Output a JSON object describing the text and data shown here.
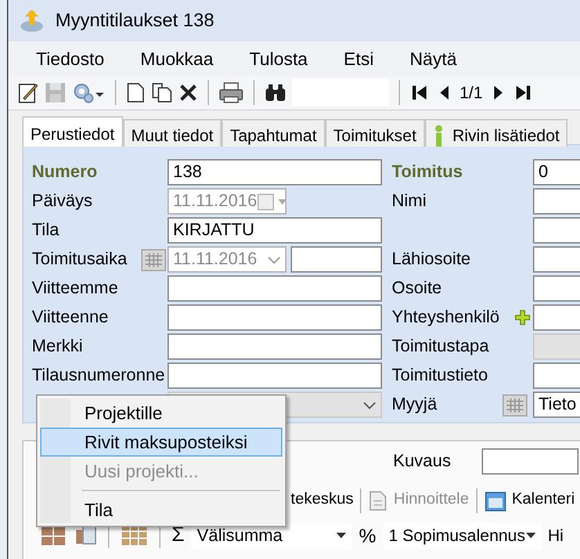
{
  "window": {
    "title": "Myyntitilaukset 138"
  },
  "menu_bar": [
    "Tiedosto",
    "Muokkaa",
    "Tulosta",
    "Etsi",
    "Näytä"
  ],
  "toolbar": {
    "page": "1/1"
  },
  "tabs": [
    {
      "label": "Perustiedot",
      "selected": true
    },
    {
      "label": "Muut tiedot",
      "selected": false
    },
    {
      "label": "Tapahtumat",
      "selected": false
    },
    {
      "label": "Toimitukset",
      "selected": false
    },
    {
      "label": "Rivin lisätiedot",
      "selected": false,
      "kind": "info"
    }
  ],
  "form": {
    "left": [
      {
        "label": "Numero",
        "emphasis": true,
        "kind": "text",
        "value": "138"
      },
      {
        "label": "Päiväys",
        "kind": "date",
        "value": "11.11.2016",
        "disabled": true
      },
      {
        "label": "Tila",
        "kind": "text",
        "value": "KIRJATTU"
      },
      {
        "label": "Toimitusaika",
        "kind": "date_split",
        "value": "11.11.2016",
        "disabled": true
      },
      {
        "label": "Viitteemme",
        "kind": "text"
      },
      {
        "label": "Viitteenne",
        "kind": "text"
      },
      {
        "label": "Merkki",
        "kind": "text"
      },
      {
        "label": "Tilausnumeronne",
        "kind": "text"
      },
      {
        "kind": "combo"
      }
    ],
    "right": [
      {
        "label": "Toimitus",
        "emphasis": true,
        "kind": "text",
        "value": "0"
      },
      {
        "label": "Nimi",
        "kind": "text"
      },
      {
        "kind": "text"
      },
      {
        "label": "Lähiosoite",
        "kind": "text"
      },
      {
        "label": "Osoite",
        "kind": "text"
      },
      {
        "label": "Yhteyshenkilö",
        "kind": "contact"
      },
      {
        "label": "Toimitustapa",
        "kind": "text",
        "disabled": true
      },
      {
        "label": "Toimitustieto",
        "kind": "text"
      },
      {
        "label": "Myyjä",
        "kind": "lookup",
        "value": "Tieto"
      }
    ]
  },
  "lower": {
    "description_label": "Kuvaus",
    "toolbar": [
      {
        "label": "tekeskus",
        "kind": "plain",
        "disabled": false
      },
      {
        "label": "Hinnoittele",
        "kind": "pricing",
        "disabled": true
      },
      {
        "label": "Kalenteri",
        "kind": "calendar",
        "disabled": false
      }
    ],
    "row_toolbar": {
      "sum": "Σ",
      "subtotal": "Välisumma",
      "percent": "%",
      "discount": "1 Sopimusalennus",
      "next": "Hi"
    }
  },
  "context_menu": [
    {
      "kind": "item",
      "label": "Projektille",
      "selected": false,
      "disabled": false
    },
    {
      "kind": "item",
      "label": "Rivit maksuposteiksi",
      "selected": true,
      "disabled": false
    },
    {
      "kind": "item",
      "label": "Uusi projekti...",
      "selected": false,
      "disabled": true
    },
    {
      "kind": "separator"
    },
    {
      "kind": "item",
      "label": "Tila",
      "selected": false,
      "disabled": false
    }
  ]
}
